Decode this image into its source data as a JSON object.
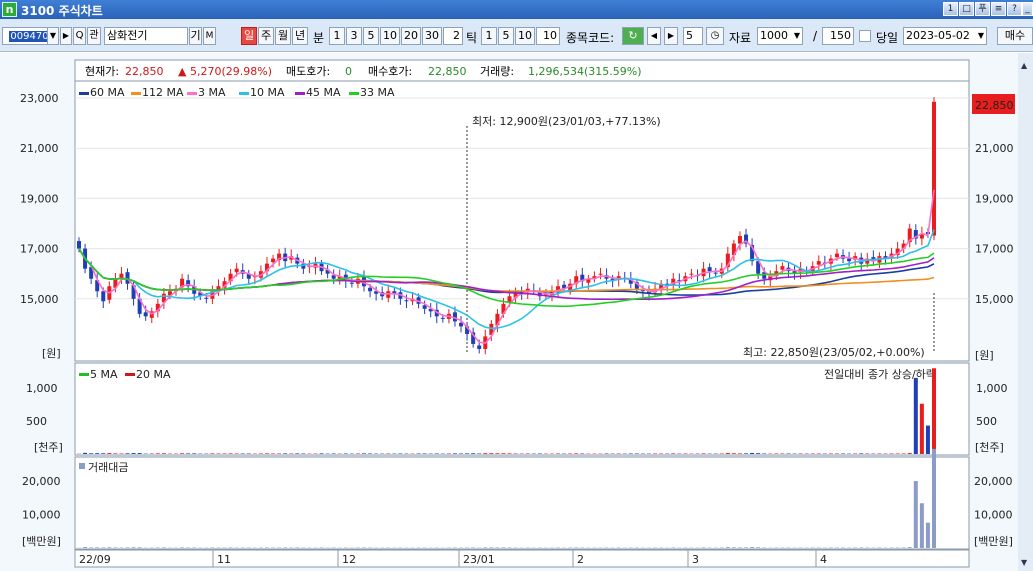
{
  "window": {
    "app_icon": "n",
    "title": "3100 주식차트",
    "buttons": [
      "1",
      "□",
      "푸",
      "≡",
      "?",
      "_"
    ]
  },
  "toolbar": {
    "code": "009470",
    "name": "삼화전기",
    "gi_label": "기",
    "m_label": "M",
    "periods": [
      "일",
      "주",
      "월",
      "년"
    ],
    "selected_period": "일",
    "minute_label": "분",
    "minutes": [
      "1",
      "3",
      "5",
      "10",
      "20",
      "30"
    ],
    "tick_value": "2",
    "tick_label": "틱",
    "ticks": [
      "1",
      "5",
      "10"
    ],
    "tick_input": "10",
    "stock_code_label": "종목코드:",
    "step_value": "5",
    "data_label": "자료",
    "data_count": "1000",
    "page_sep": "/",
    "page_value": "150",
    "today_label": "당일",
    "date_value": "2023-05-02",
    "buy_label": "매수"
  },
  "info_bar": {
    "current_label": "현재가:",
    "current_value": "22,850",
    "change_value": "5,270(29.98%)",
    "ask_label": "매도호가:",
    "ask_value": "0",
    "bid_label": "매수호가:",
    "bid_value": "22,850",
    "volume_label": "거래량:",
    "volume_value": "1,296,534(315.59%)"
  },
  "colors": {
    "up": "#e81e1e",
    "down": "#1f3fb8",
    "ma60": "#1d3f9a",
    "ma112": "#f0901e",
    "ma3": "#ff6ec7",
    "ma10": "#2cc2e8",
    "ma45": "#a020c8",
    "ma33": "#22d022",
    "vol5": "#22c022",
    "vol20": "#d01818",
    "turnover": "#8c9cc8"
  },
  "chart_data": [
    {
      "type": "line",
      "title": "",
      "legend": [
        {
          "name": "60 MA",
          "color": "#1d3f9a"
        },
        {
          "name": "112 MA",
          "color": "#f0901e"
        },
        {
          "name": "3 MA",
          "color": "#ff6ec7"
        },
        {
          "name": "10 MA",
          "color": "#2cc2e8"
        },
        {
          "name": "45 MA",
          "color": "#a020c8"
        },
        {
          "name": "33 MA",
          "color": "#22d022"
        }
      ],
      "y_ticks": [
        "23,000",
        "21,000",
        "19,000",
        "17,000",
        "15,000"
      ],
      "ylim": [
        12600,
        23600
      ],
      "y_unit": "[원]",
      "x_ticks": [
        "22/09",
        "11",
        "12",
        "23/01",
        "2",
        "3",
        "4"
      ],
      "price_badge": "22,850",
      "low_annotation": "최저: 12,900원(23/01/03,+77.13%)",
      "high_annotation": "최고: 22,850원(23/05/02,+0.00%)",
      "candle_closes": [
        17000,
        16200,
        15800,
        15300,
        14900,
        15500,
        15800,
        16000,
        15600,
        15000,
        14400,
        14300,
        14500,
        14800,
        15200,
        15300,
        15400,
        15800,
        15500,
        15200,
        15100,
        15000,
        15300,
        15500,
        15700,
        16000,
        16200,
        16000,
        15800,
        15900,
        16100,
        16400,
        16600,
        16800,
        16500,
        16700,
        16400,
        16200,
        16300,
        16400,
        16100,
        16000,
        15800,
        15900,
        15700,
        15600,
        15800,
        15500,
        15300,
        15200,
        15100,
        15300,
        15200,
        15000,
        14900,
        15000,
        14800,
        14600,
        14500,
        14300,
        14200,
        14400,
        14100,
        13900,
        13600,
        13200,
        13000,
        13500,
        14000,
        14400,
        14800,
        15100,
        15300,
        15200,
        15400,
        15300,
        15100,
        15200,
        15300,
        15500,
        15400,
        15600,
        15900,
        15700,
        15800,
        15900,
        16000,
        15800,
        15700,
        15900,
        15800,
        15600,
        15400,
        15300,
        15200,
        15400,
        15600,
        15500,
        15800,
        15700,
        15900,
        16000,
        15900,
        16200,
        16100,
        16000,
        16200,
        16800,
        17200,
        17500,
        17200,
        16500,
        16000,
        15800,
        15900,
        16100,
        16300,
        16100,
        16000,
        16200,
        16100,
        16300,
        16500,
        16400,
        16600,
        16800,
        16600,
        16500,
        16700,
        16400,
        16600,
        16500,
        16700,
        16600,
        16800,
        17000,
        17200,
        17800,
        17400,
        17600,
        17580,
        22850
      ],
      "volume_legend": [
        {
          "name": "5 MA",
          "color": "#22c022"
        },
        {
          "name": "20 MA",
          "color": "#d01818"
        }
      ],
      "volume_y_ticks": [
        "1,000",
        "500"
      ],
      "volume_unit": "[천주]",
      "volume_note": "전일대비 종가 상승/하락",
      "turnover_legend": "거래대금",
      "turnover_y_ticks": [
        "20,000",
        "10,000"
      ],
      "turnover_unit": "[백만원]"
    }
  ]
}
